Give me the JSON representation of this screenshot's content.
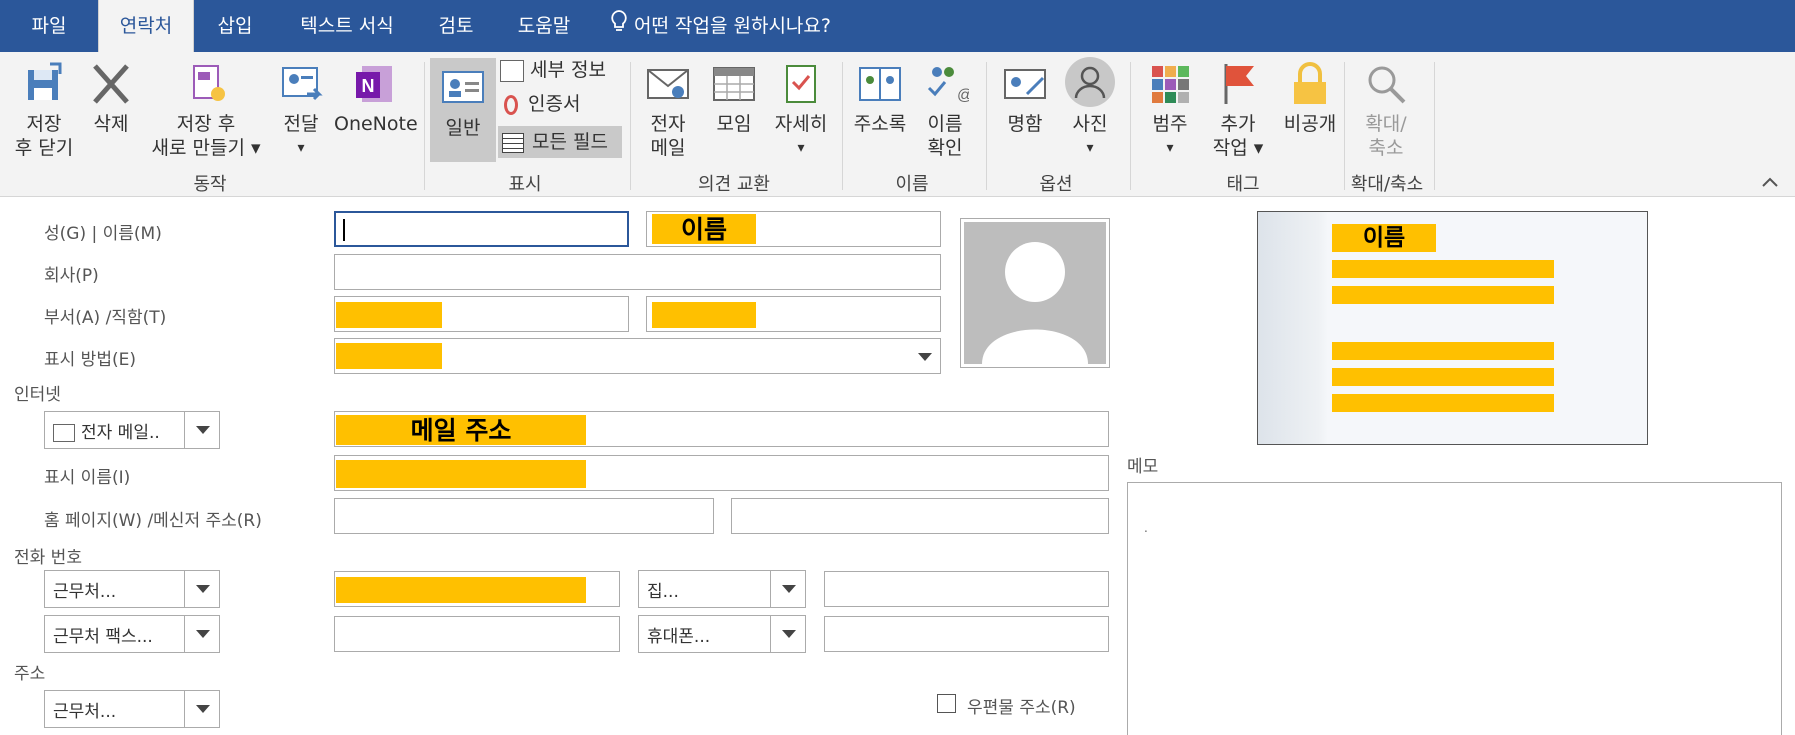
{
  "tabs": [
    "파일",
    "연락처",
    "삽입",
    "텍스트 서식",
    "검토",
    "도움말"
  ],
  "search_hint": "어떤 작업을 원하시나요?",
  "ribbon": {
    "save_close": [
      "저장",
      "후 닫기"
    ],
    "delete": "삭제",
    "save_new": [
      "저장 후",
      "새로 만들기 ▾"
    ],
    "forward": [
      "전달",
      "▾"
    ],
    "onenote": "OneNote",
    "group_actions": "동작",
    "general": "일반",
    "details": "세부 정보",
    "certificates": "인증서",
    "all_fields": "모든 필드",
    "group_show": "표시",
    "email": [
      "전자",
      "메일"
    ],
    "meeting": "모임",
    "more": [
      "자세히",
      "▾"
    ],
    "group_communicate": "의견 교환",
    "address_book": "주소록",
    "check_names": [
      "이름",
      "확인"
    ],
    "group_names": "이름",
    "business_card": "명함",
    "picture": [
      "사진",
      "▾"
    ],
    "group_options": "옵션",
    "categorize": [
      "범주",
      "▾"
    ],
    "follow_up": [
      "추가",
      "작업 ▾"
    ],
    "private": "비공개",
    "group_tags": "태그",
    "zoom": [
      "확대/",
      "축소"
    ],
    "group_zoom": "확대/축소"
  },
  "form": {
    "name_label": "성(G)    | 이름(M)",
    "company_label": "회사(P)",
    "dept_label": "부서(A)   /직함(T)",
    "file_as_label": "표시 방법(E)",
    "internet_label": "인터넷",
    "email_dd": "전자 메일..",
    "display_as_label": "표시 이름(I)",
    "web_label": "홈 페이지(W)   /메신저 주소(R)",
    "phone_label": "전화 번호",
    "business_dd": "근무처...",
    "home_dd": "집...",
    "bizfax_dd": "근무처 팩스...",
    "mobile_dd": "휴대폰...",
    "address_label": "주소",
    "address_dd": "근무처...",
    "mailing_label": "우편물 주소(R)",
    "notes_label": "메모",
    "notes_text": ".",
    "name_redact": "이름",
    "email_redact": "메일 주소",
    "card_name_redact": "이름"
  },
  "colors": {
    "ribbon_blue": "#2b579a",
    "redaction": "#ffc000"
  }
}
